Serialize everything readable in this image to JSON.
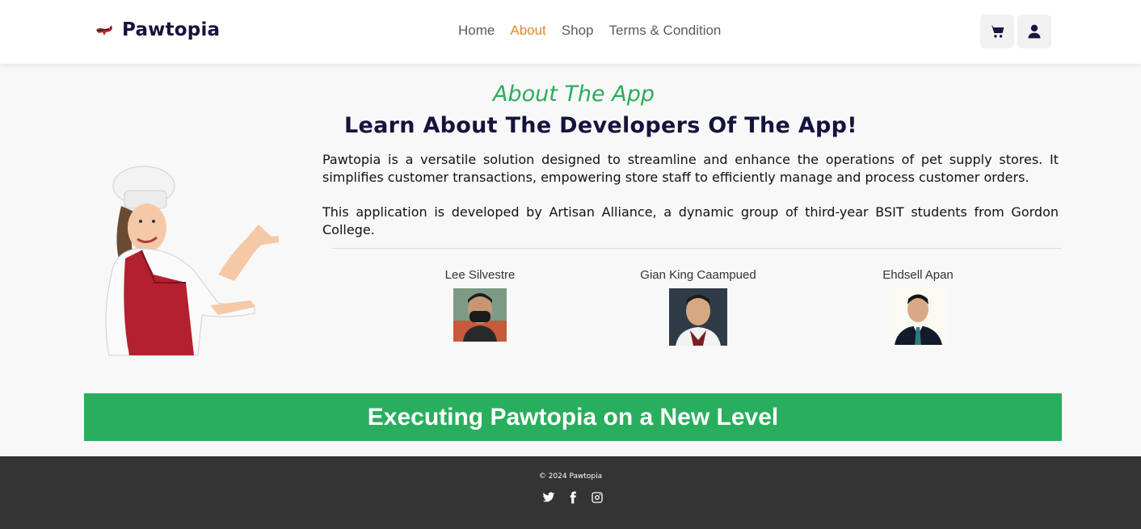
{
  "brand": {
    "name": "Pawtopia",
    "logo_icon": "dog-logo-icon"
  },
  "nav": {
    "links": [
      {
        "label": "Home",
        "active": false
      },
      {
        "label": "About",
        "active": true
      },
      {
        "label": "Shop",
        "active": false
      },
      {
        "label": "Terms & Condition",
        "active": false
      }
    ],
    "active_color": "#e08a2c",
    "icons": [
      "cart-icon",
      "user-icon"
    ]
  },
  "about": {
    "subtitle": "About The App",
    "title": "Learn About The Developers Of The App!",
    "paragraph1": "Pawtopia is a versatile solution designed to streamline and enhance the operations of pet supply stores. It simplifies customer transactions, empowering store staff to efficiently manage and process customer orders.",
    "paragraph2": "This application is developed by Artisan Alliance, a dynamic group of third-year BSIT students from Gordon College."
  },
  "developers": [
    {
      "name": "Lee Silvestre"
    },
    {
      "name": "Gian King Caampued"
    },
    {
      "name": "Ehdsell Apan"
    }
  ],
  "banner": {
    "text": "Executing Pawtopia on a New Level",
    "color": "#29ae5e"
  },
  "footer": {
    "copyright": "© 2024 Pawtopia",
    "socials": [
      "twitter-icon",
      "facebook-icon",
      "instagram-icon"
    ]
  }
}
